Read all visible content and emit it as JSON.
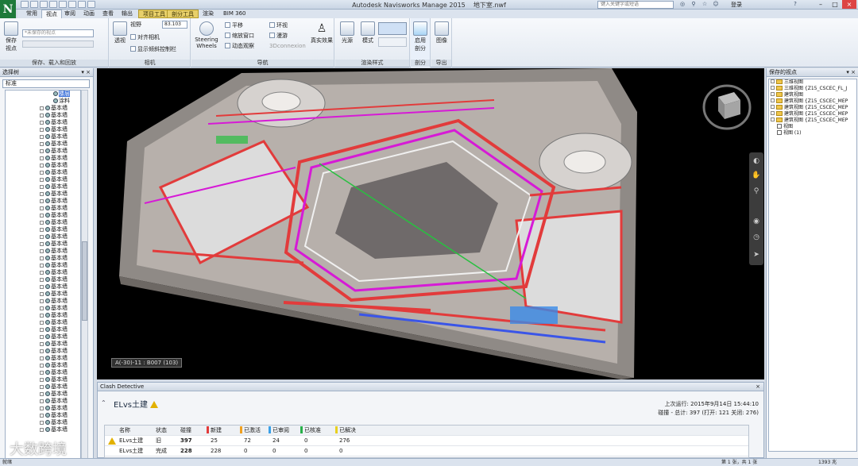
{
  "window": {
    "title": "Autodesk Navisworks Manage 2015    地下室.nwf",
    "search_placeholder": "键入关键字或短语",
    "signin": "登录",
    "logo": "N"
  },
  "tabs": [
    "常用",
    "视点",
    "审阅",
    "动画",
    "查看",
    "输出",
    "项目工具",
    "剖分工具",
    "渲染",
    "BIM 360"
  ],
  "ribbon": {
    "save_view": "保存\n视点",
    "view_combo": "*未保存的视点",
    "group_save": "保存、载入和回放",
    "perspective": "透视",
    "field": "视野",
    "field_value": "83.103",
    "align_camera": "对齐相机",
    "tilt_control": "显示倾斜控制栏",
    "group_camera": "相机",
    "steering": "Steering\nWheels",
    "pan": "平移",
    "zoom_window": "缩放窗口",
    "orbit": "动态观察",
    "look": "环视",
    "walk": "漫游",
    "connexion": "3Dconnexion",
    "realism": "真实效果",
    "group_nav": "导航",
    "light": "光源",
    "mode": "模式",
    "group_render": "渲染样式",
    "enable_section": "启用\n剖分",
    "group_section": "剖分",
    "image": "图像",
    "group_export": "导出"
  },
  "left_panel": {
    "title": "选择树",
    "combo_value": "标准",
    "items": [
      {
        "label": "楼层",
        "type": "folder",
        "selected": true
      },
      {
        "label": "涂料",
        "type": "item"
      },
      {
        "label": "基本墙",
        "type": "item"
      }
    ],
    "repeat_label": "基本墙"
  },
  "viewport": {
    "view_label": "A(-30)-11 : B007 (103)"
  },
  "right_panel": {
    "title": "保存的视点",
    "items": [
      {
        "label": "三维视图",
        "type": "folder"
      },
      {
        "label": "三维视图 {Z15_CSCEC_FL_J",
        "type": "folder"
      },
      {
        "label": "建筑视图",
        "type": "folder"
      },
      {
        "label": "建筑视图 {Z15_CSCEC_MEP",
        "type": "folder"
      },
      {
        "label": "建筑视图 {Z15_CSCEC_MEP",
        "type": "folder"
      },
      {
        "label": "建筑视图 {Z15_CSCEC_MEP",
        "type": "folder"
      },
      {
        "label": "建筑视图 {Z15_CSCEC_MEP",
        "type": "folder"
      },
      {
        "label": "视图",
        "type": "view"
      },
      {
        "label": "视图 (1)",
        "type": "view"
      }
    ]
  },
  "clash": {
    "panel_title": "Clash Detective",
    "test_name": "ELvs土建",
    "last_run_label": "上次运行:",
    "last_run_value": "2015年9月14日 15:44:10",
    "stats": "碰撞 - 总计: 397 (打开: 121  关闭: 276)",
    "columns": [
      "名称",
      "状态",
      "碰撞",
      "新建",
      "已激活",
      "已审阅",
      "已核准",
      "已解决"
    ],
    "column_colors": [
      "",
      "",
      "",
      "#e23b3b",
      "#f0a020",
      "#3aa0e8",
      "#28b04a",
      "#e8d020"
    ],
    "rows": [
      [
        "ELvs土建",
        "旧",
        "397",
        "25",
        "72",
        "24",
        "0",
        "276"
      ],
      [
        "ELvs土建",
        "完成",
        "228",
        "228",
        "0",
        "0",
        "0",
        "0"
      ]
    ]
  },
  "statusbar": {
    "ready": "就绪",
    "page": "第 1 张，共 1 张",
    "memory": "1393 兆"
  },
  "watermark": "大数跨境"
}
